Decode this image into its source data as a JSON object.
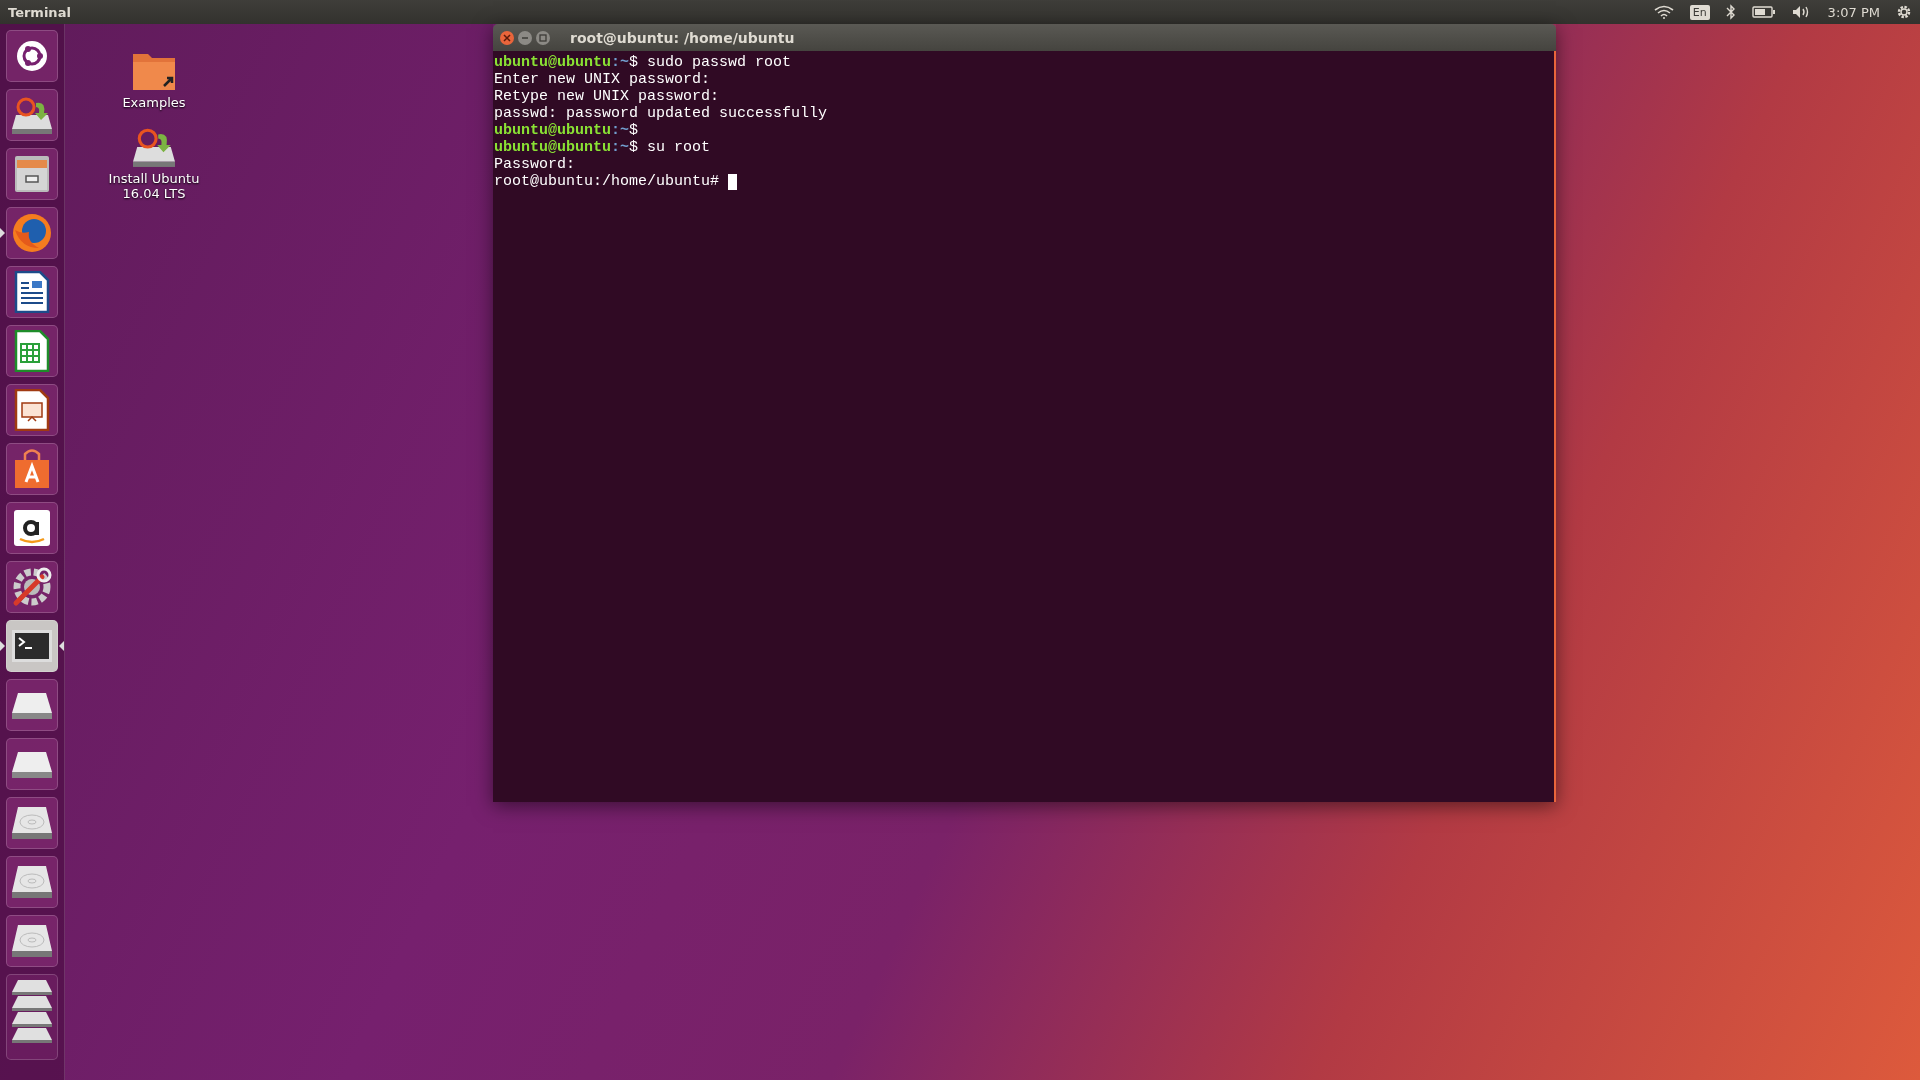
{
  "top_bar": {
    "app_title": "Terminal",
    "keyboard_layout": "En",
    "clock": "3:07 PM"
  },
  "launcher": {
    "items": [
      {
        "kind": "dash",
        "running": false,
        "focused": false
      },
      {
        "kind": "installer",
        "running": false,
        "focused": false
      },
      {
        "kind": "files",
        "running": false,
        "focused": false
      },
      {
        "kind": "browser",
        "running": true,
        "focused": false
      },
      {
        "kind": "writer",
        "running": false,
        "focused": false
      },
      {
        "kind": "calc",
        "running": false,
        "focused": false
      },
      {
        "kind": "impress",
        "running": false,
        "focused": false
      },
      {
        "kind": "software",
        "running": false,
        "focused": false
      },
      {
        "kind": "amazon",
        "running": false,
        "focused": false
      },
      {
        "kind": "settings",
        "running": false,
        "focused": false
      },
      {
        "kind": "terminal",
        "running": true,
        "focused": true
      },
      {
        "kind": "removable",
        "running": false,
        "focused": false
      },
      {
        "kind": "removable",
        "running": false,
        "focused": false
      },
      {
        "kind": "disk",
        "running": false,
        "focused": false
      },
      {
        "kind": "disk",
        "running": false,
        "focused": false
      },
      {
        "kind": "disk",
        "running": false,
        "focused": false
      },
      {
        "kind": "folded",
        "running": false,
        "focused": false
      }
    ]
  },
  "desktop_icons": [
    {
      "kind": "folder",
      "label": "Examples"
    },
    {
      "kind": "installer",
      "label": "Install Ubuntu 16.04 LTS"
    }
  ],
  "terminal_window": {
    "title": "root@ubuntu: /home/ubuntu",
    "lines": [
      {
        "kind": "prompt",
        "user": "ubuntu@ubuntu",
        "path": ":~",
        "command": "$ sudo passwd root"
      },
      {
        "kind": "output",
        "text": "Enter new UNIX password:"
      },
      {
        "kind": "output",
        "text": "Retype new UNIX password:"
      },
      {
        "kind": "output",
        "text": "passwd: password updated successfully"
      },
      {
        "kind": "prompt",
        "user": "ubuntu@ubuntu",
        "path": ":~",
        "command": "$"
      },
      {
        "kind": "prompt",
        "user": "ubuntu@ubuntu",
        "path": ":~",
        "command": "$ su root"
      },
      {
        "kind": "output",
        "text": "Password:"
      },
      {
        "kind": "cursor_line",
        "text": "root@ubuntu:/home/ubuntu#"
      }
    ]
  }
}
